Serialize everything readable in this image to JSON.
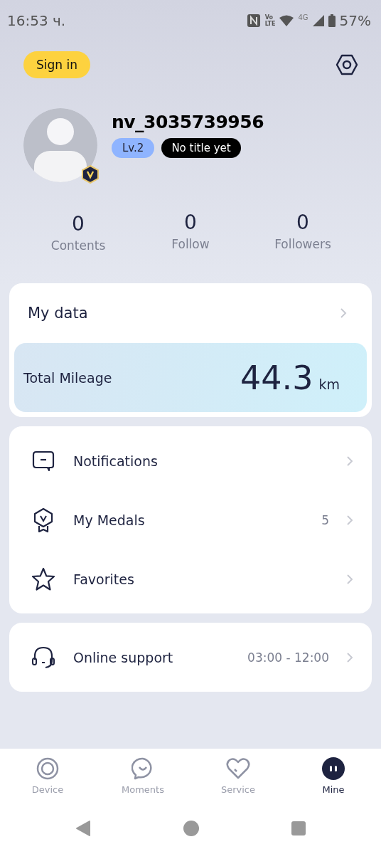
{
  "status_bar": {
    "time": "16:53 ч.",
    "volte": [
      "Vo",
      "LTE"
    ],
    "network": "4G",
    "battery": "57%"
  },
  "header": {
    "sign_in": "Sign in"
  },
  "profile": {
    "username": "nv_3035739956",
    "level": "Lv.2",
    "title_badge": "No title yet"
  },
  "stats": [
    {
      "value": "0",
      "label": "Contents"
    },
    {
      "value": "0",
      "label": "Follow"
    },
    {
      "value": "0",
      "label": "Followers"
    }
  ],
  "my_data": {
    "title": "My data",
    "mileage_label": "Total Mileage",
    "mileage_value": "44.3",
    "mileage_unit": "km"
  },
  "menu_groups": [
    [
      {
        "kind": "notifications",
        "label": "Notifications"
      },
      {
        "kind": "medals",
        "label": "My Medals",
        "value": "5"
      },
      {
        "kind": "favorites",
        "label": "Favorites"
      }
    ],
    [
      {
        "kind": "support",
        "label": "Online support",
        "value": "03:00 - 12:00"
      }
    ]
  ],
  "tabs": [
    {
      "kind": "device",
      "label": "Device",
      "selected": false
    },
    {
      "kind": "moments",
      "label": "Moments",
      "selected": false
    },
    {
      "kind": "service",
      "label": "Service",
      "selected": false
    },
    {
      "kind": "mine",
      "label": "Mine",
      "selected": true
    }
  ]
}
